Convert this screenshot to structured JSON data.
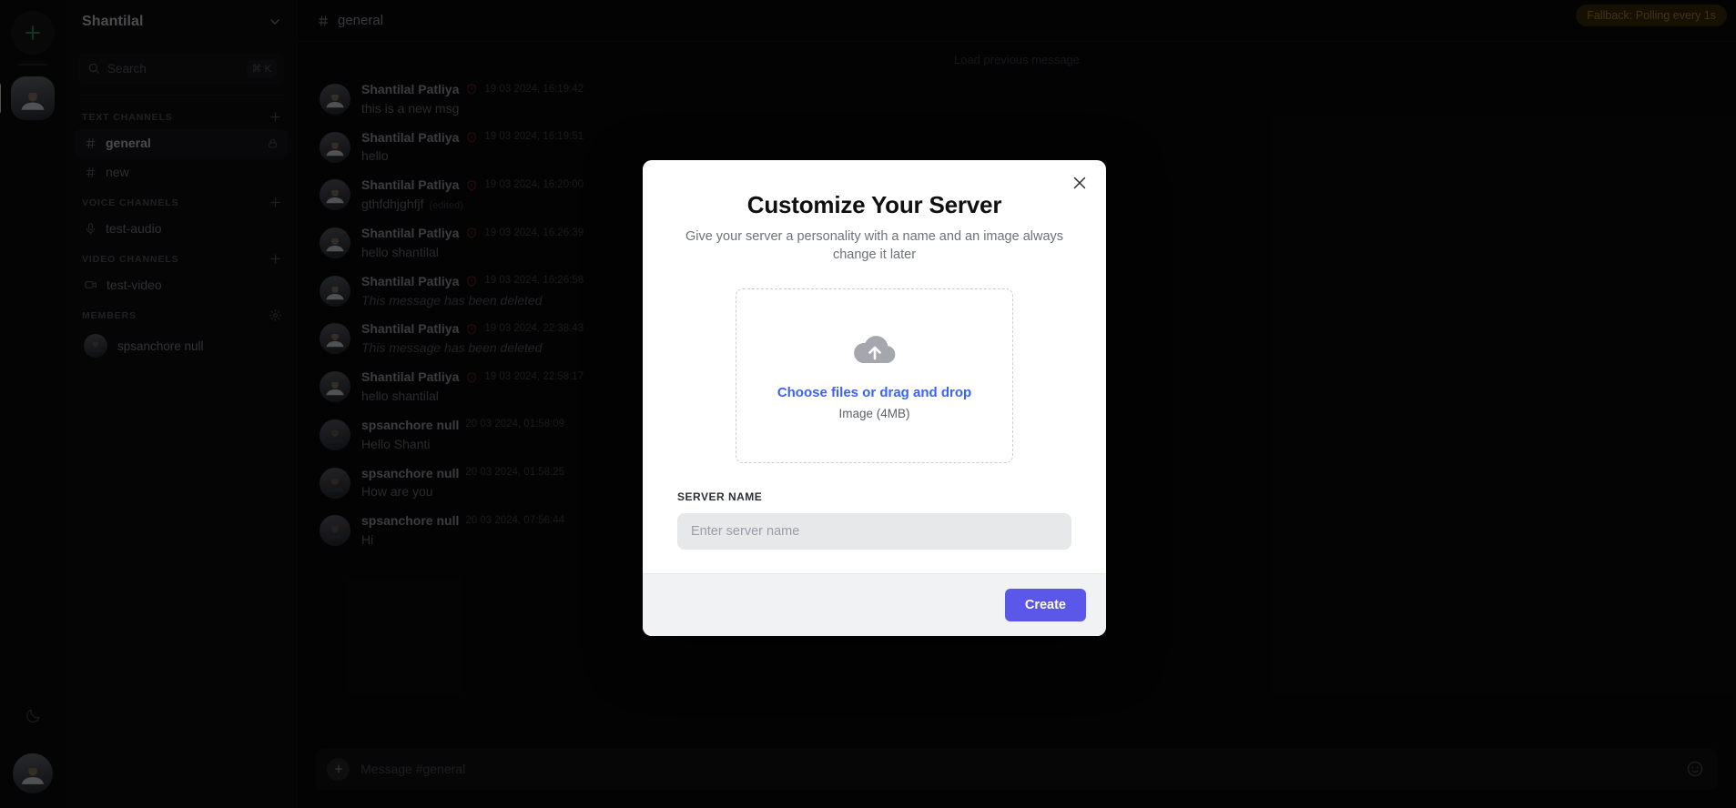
{
  "rail": {
    "add_server_label": "+",
    "add_server_color": "#2f8a5f",
    "servers": [
      {
        "name": "Shantilal",
        "active": true
      }
    ],
    "theme_toggle_icon": "moon-icon",
    "user_avatar_icon": "user-avatar"
  },
  "sidebar": {
    "title": "Shantilal",
    "chevron_icon": "chevron-down-icon",
    "search": {
      "placeholder": "Search",
      "icon": "search-icon",
      "shortcut": "⌘ K"
    },
    "groups": [
      {
        "label": "TEXT CHANNELS",
        "add_icon": "plus-icon",
        "items": [
          {
            "name": "general",
            "icon": "hash-icon",
            "active": true,
            "locked": true
          },
          {
            "name": "new",
            "icon": "hash-icon",
            "active": false,
            "locked": false
          }
        ]
      },
      {
        "label": "VOICE CHANNELS",
        "add_icon": "plus-icon",
        "items": [
          {
            "name": "test-audio",
            "icon": "microphone-icon",
            "active": false,
            "locked": false
          }
        ]
      },
      {
        "label": "VIDEO CHANNELS",
        "add_icon": "plus-icon",
        "items": [
          {
            "name": "test-video",
            "icon": "video-camera-icon",
            "active": false,
            "locked": false
          }
        ]
      }
    ],
    "members": {
      "label": "MEMBERS",
      "settings_icon": "gear-icon",
      "items": [
        {
          "name": "spsanchore null"
        }
      ]
    }
  },
  "main": {
    "channel_icon": "hash-icon",
    "channel_name": "general",
    "fallback_badge": "Fallback: Polling every 1s",
    "load_previous": "Load previous message",
    "messages": [
      {
        "author": "Shantilal Patliya",
        "admin": true,
        "time": "19 03 2024, 16:19:42",
        "text": "this is a new msg",
        "deleted": false,
        "edited": false
      },
      {
        "author": "Shantilal Patliya",
        "admin": true,
        "time": "19 03 2024, 16:19:51",
        "text": "hello",
        "deleted": false,
        "edited": false
      },
      {
        "author": "Shantilal Patliya",
        "admin": true,
        "time": "19 03 2024, 16:20:00",
        "text": "gthfdhjghfjf",
        "deleted": false,
        "edited": true,
        "edited_label": "(edited)"
      },
      {
        "author": "Shantilal Patliya",
        "admin": true,
        "time": "19 03 2024, 16:26:39",
        "text": "hello shantilal",
        "deleted": false,
        "edited": false
      },
      {
        "author": "Shantilal Patliya",
        "admin": true,
        "time": "19 03 2024, 16:26:58",
        "text": "This message has been deleted",
        "deleted": true,
        "edited": false
      },
      {
        "author": "Shantilal Patliya",
        "admin": true,
        "time": "19 03 2024, 22:38:43",
        "text": "This message has been deleted",
        "deleted": true,
        "edited": false
      },
      {
        "author": "Shantilal Patliya",
        "admin": true,
        "time": "19 03 2024, 22:58:17",
        "text": "hello shantilal",
        "deleted": false,
        "edited": false
      },
      {
        "author": "spsanchore null",
        "admin": false,
        "time": "20 03 2024, 01:58:09",
        "text": "Hello Shanti",
        "deleted": false,
        "edited": false
      },
      {
        "author": "spsanchore null",
        "admin": false,
        "time": "20 03 2024, 01:58:25",
        "text": "How are you",
        "deleted": false,
        "edited": false
      },
      {
        "author": "spsanchore null",
        "admin": false,
        "time": "20 03 2024, 07:56:44",
        "text": "Hi",
        "deleted": false,
        "edited": false
      }
    ],
    "composer": {
      "placeholder": "Message #general",
      "plus_icon": "plus-icon",
      "emoji_icon": "smiley-icon"
    }
  },
  "modal": {
    "title": "Customize Your Server",
    "subtitle": "Give your server a personality with a name and an image always change it later",
    "close_icon": "close-icon",
    "dropzone": {
      "icon": "cloud-upload-icon",
      "link_label": "Choose files or drag and drop",
      "hint": "Image (4MB)"
    },
    "server_name_label": "SERVER NAME",
    "server_name_value": "",
    "server_name_placeholder": "Enter server name",
    "create_label": "Create",
    "accent_color": "#5b57e8",
    "link_color": "#3b62f6"
  }
}
